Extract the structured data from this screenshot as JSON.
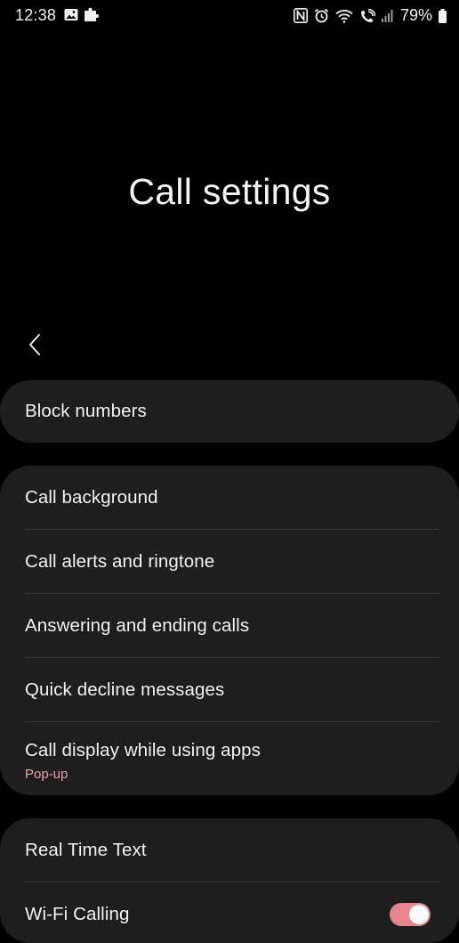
{
  "status_bar": {
    "time": "12:38",
    "battery": "79%",
    "left_icons": [
      "gallery-icon",
      "puzzle-icon"
    ],
    "right_icons": [
      "nfc-icon",
      "alarm-icon",
      "wifi-icon",
      "wifi-calling-icon",
      "signal-icon",
      "battery-icon"
    ]
  },
  "header": {
    "title": "Call settings",
    "back_icon": "chevron-left-icon"
  },
  "groups": [
    {
      "items": [
        {
          "label": "Block numbers"
        }
      ]
    },
    {
      "items": [
        {
          "label": "Call background"
        },
        {
          "label": "Call alerts and ringtone"
        },
        {
          "label": "Answering and ending calls"
        },
        {
          "label": "Quick decline messages"
        },
        {
          "label": "Call display while using apps",
          "subtitle": "Pop-up"
        }
      ]
    },
    {
      "items": [
        {
          "label": "Real Time Text"
        },
        {
          "label": "Wi-Fi Calling",
          "toggle": true
        }
      ]
    }
  ],
  "colors": {
    "background": "#000000",
    "card": "#1e1e1e",
    "accent": "#e8868d",
    "subtitle": "#e8a0a6"
  }
}
